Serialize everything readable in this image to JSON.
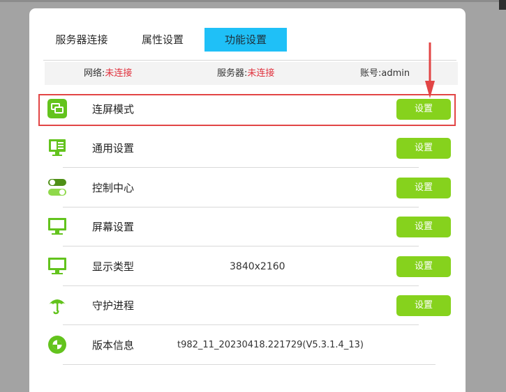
{
  "tabs": [
    {
      "label": "服务器连接"
    },
    {
      "label": "属性设置"
    },
    {
      "label": "功能设置",
      "active": true
    }
  ],
  "status": {
    "network_label": "网络:",
    "network_value": "未连接",
    "server_label": "服务器:",
    "server_value": "未连接",
    "account": "账号:admin"
  },
  "rows": [
    {
      "icon": "screen-mirror-icon",
      "label": "连屏模式",
      "value": "",
      "button": "设置"
    },
    {
      "icon": "monitor-settings-icon",
      "label": "通用设置",
      "value": "",
      "button": "设置"
    },
    {
      "icon": "toggle-icon",
      "label": "控制中心",
      "value": "",
      "button": "设置"
    },
    {
      "icon": "monitor-icon",
      "label": "屏幕设置",
      "value": "",
      "button": "设置"
    },
    {
      "icon": "monitor-icon",
      "label": "显示类型",
      "value": "3840x2160",
      "button": "设置"
    },
    {
      "icon": "umbrella-icon",
      "label": "守护进程",
      "value": "",
      "button": "设置"
    },
    {
      "icon": "version-icon",
      "label": "版本信息",
      "value": "t982_11_20230418.221729(V5.3.1.4_13)",
      "button": ""
    }
  ],
  "colors": {
    "accent_tab": "#1fc0f7",
    "button_green": "#86d21d",
    "icon_green": "#63c31d",
    "status_red": "#e0303c",
    "annotation_red": "#e24545"
  }
}
